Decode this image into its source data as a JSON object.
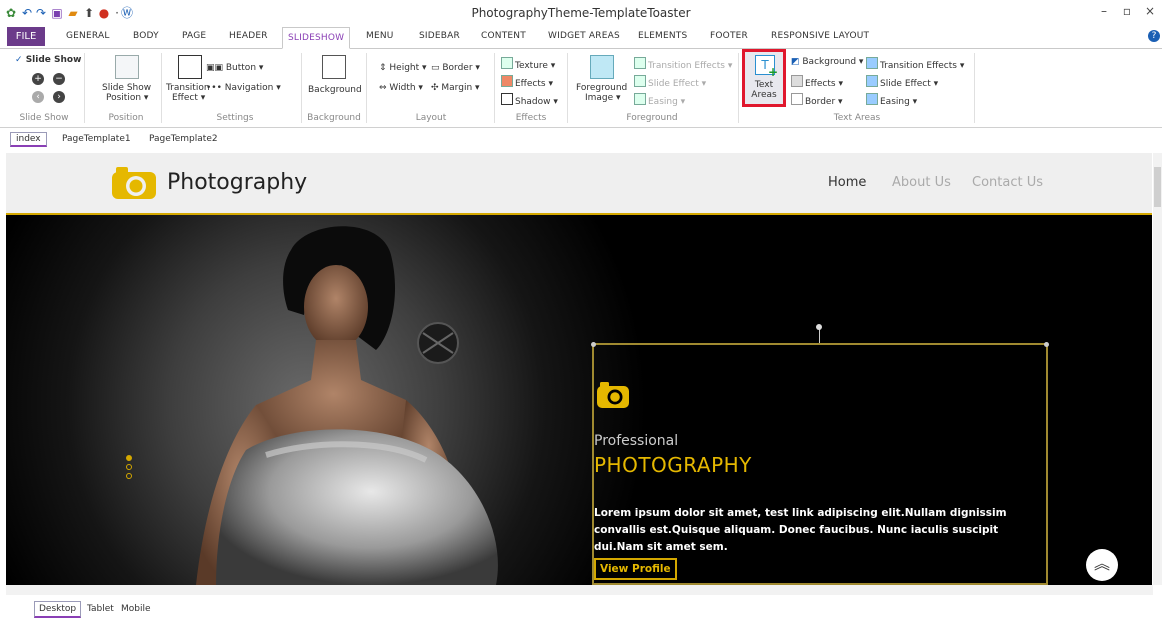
{
  "app": {
    "title": "PhotographyTheme-TemplateToaster"
  },
  "menu": {
    "file": "FILE",
    "tabs": [
      "GENERAL",
      "BODY",
      "PAGE",
      "HEADER",
      "SLIDESHOW",
      "MENU",
      "SIDEBAR",
      "CONTENT",
      "WIDGET AREAS",
      "ELEMENTS",
      "FOOTER",
      "RESPONSIVE LAYOUT"
    ],
    "active": "SLIDESHOW"
  },
  "ribbon": {
    "slideshow": {
      "checkbox": "Slide Show",
      "label": "Slide Show"
    },
    "position": {
      "btn_line1": "Slide Show",
      "btn_line2": "Position ▾",
      "label": "Position"
    },
    "settings": {
      "transition_line1": "Transition",
      "transition_line2": "Effect ▾",
      "button": "Button ▾",
      "navigation": "Navigation ▾",
      "label": "Settings"
    },
    "background": {
      "btn": "Background",
      "label": "Background"
    },
    "layout": {
      "height": "Height ▾",
      "border": "Border ▾",
      "width": "Width ▾",
      "margin": "Margin ▾",
      "label": "Layout"
    },
    "effects": {
      "texture": "Texture ▾",
      "effects": "Effects ▾",
      "shadow": "Shadow ▾",
      "label": "Effects"
    },
    "foreground": {
      "btn_line1": "Foreground",
      "btn_line2": "Image ▾",
      "transition": "Transition Effects ▾",
      "slide": "Slide Effect ▾",
      "easing": "Easing ▾",
      "label": "Foreground"
    },
    "textareas": {
      "btn_line1": "Text",
      "btn_line2": "Areas",
      "background": "Background ▾",
      "effects": "Effects ▾",
      "border": "Border ▾",
      "transition": "Transition Effects ▾",
      "slide": "Slide Effect ▾",
      "easing": "Easing ▾",
      "label": "Text Areas"
    }
  },
  "pagetabs": [
    "index",
    "PageTemplate1",
    "PageTemplate2"
  ],
  "site": {
    "title": "Photography",
    "nav": [
      "Home",
      "About Us",
      "Contact Us"
    ]
  },
  "slide": {
    "pre": "Professional",
    "heading": "PHOTOGRAPHY",
    "body": "Lorem ipsum dolor sit amet, test link adipiscing elit.Nullam dignissim convallis est.Quisque aliquam. Donec faucibus. Nunc iaculis suscipit dui.Nam sit amet sem.",
    "button": "View Profile"
  },
  "devtabs": [
    "Desktop",
    "Tablet",
    "Mobile"
  ],
  "colors": {
    "accent": "#d4a800",
    "file_tab": "#6b3b8a",
    "highlight": "#e0172d"
  }
}
